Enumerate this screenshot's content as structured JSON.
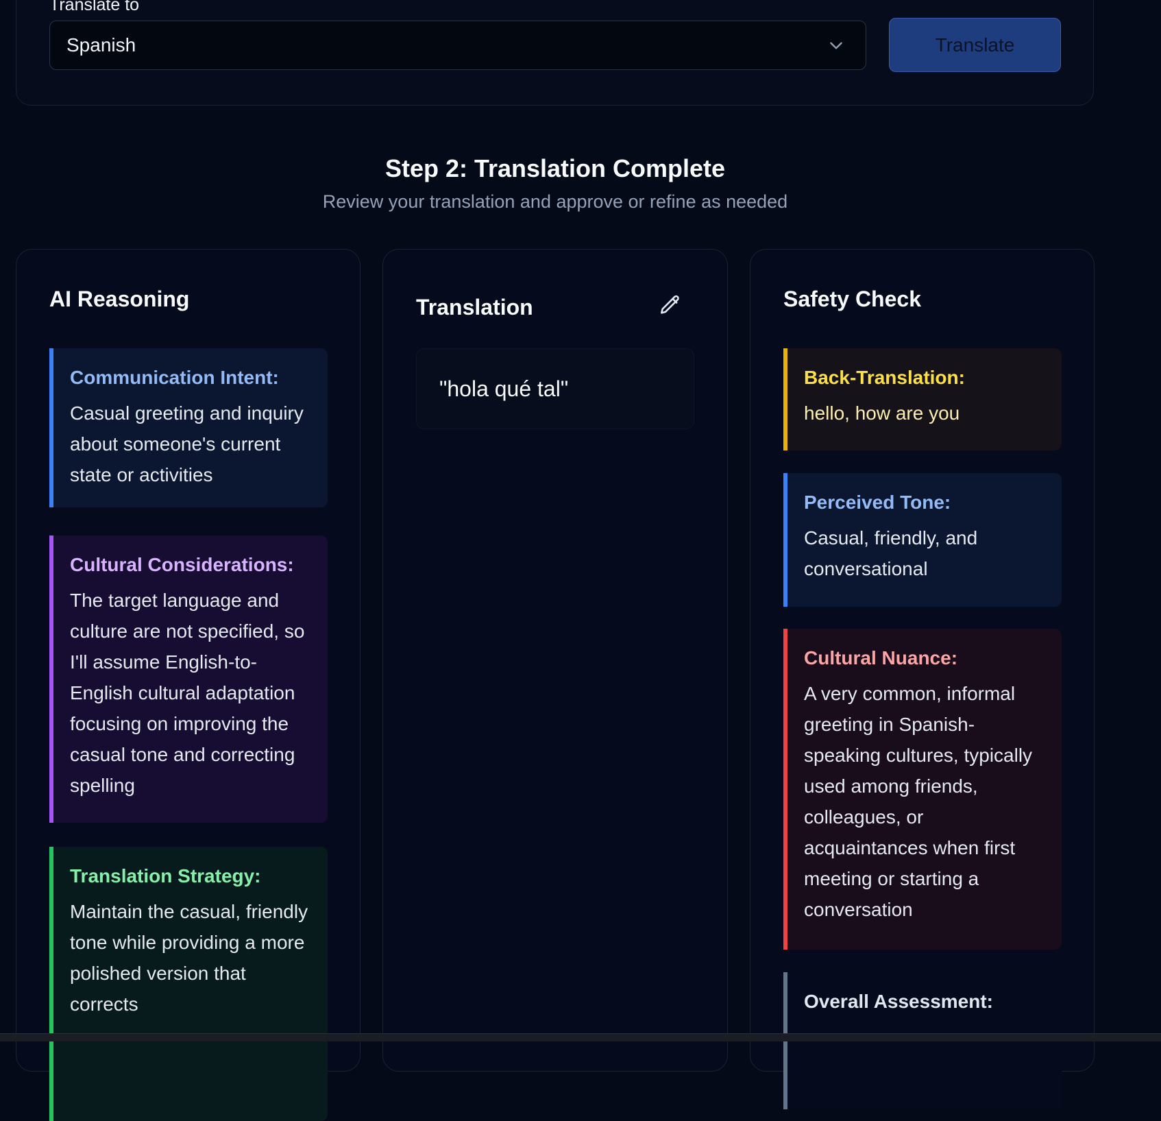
{
  "translate_section": {
    "label": "Translate to",
    "selected_language": "Spanish",
    "translate_button_label": "Translate"
  },
  "step": {
    "title": "Step 2: Translation Complete",
    "subtitle": "Review your translation and approve or refine as needed"
  },
  "reasoning": {
    "title": "AI Reasoning",
    "cards": [
      {
        "label": "Communication Intent:",
        "text": "Casual greeting and inquiry about someone's current state or activities"
      },
      {
        "label": "Cultural Considerations:",
        "text": "The target language and culture are not specified, so I'll assume English-to-English cultural adaptation focusing on improving the casual tone and correcting spelling"
      },
      {
        "label": "Translation Strategy:",
        "text": "Maintain the casual, friendly tone while providing a more polished version that corrects"
      }
    ]
  },
  "translation": {
    "title": "Translation",
    "text": "\"hola qué tal\""
  },
  "safety": {
    "title": "Safety Check",
    "cards": [
      {
        "label": "Back-Translation:",
        "text": "hello, how are you"
      },
      {
        "label": "Perceived Tone:",
        "text": "Casual, friendly, and conversational"
      },
      {
        "label": "Cultural Nuance:",
        "text": "A very common, informal greeting in Spanish-speaking cultures, typically used among friends, colleagues, or acquaintances when first meeting or starting a conversation"
      },
      {
        "label": "Overall Assessment:",
        "text": ""
      }
    ]
  },
  "colors": {
    "background": "#050a19",
    "intent_accent": "#3b82f6",
    "cultural_accent": "#a855f7",
    "strategy_accent": "#22c55e",
    "back_translation_accent": "#eab308",
    "nuance_accent": "#ef4444",
    "assessment_accent": "#64748b",
    "button_bg": "#1d3d7f"
  },
  "icons": {
    "select_arrow": "chevron-down-icon",
    "edit": "pencil-icon"
  }
}
